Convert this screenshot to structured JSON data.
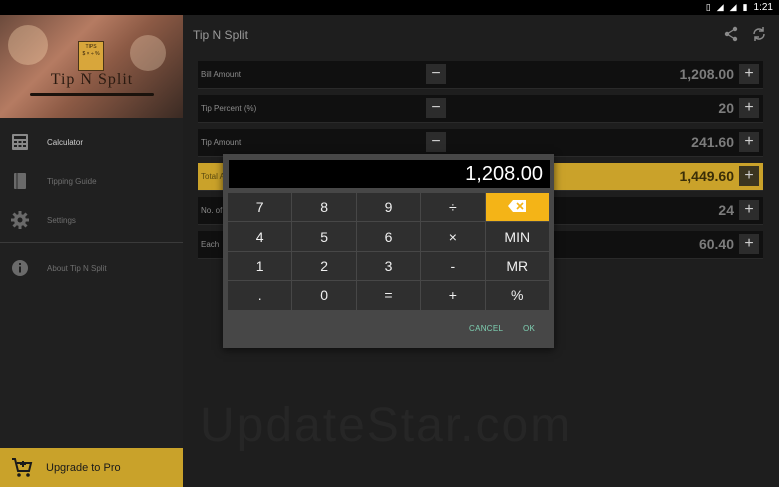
{
  "status_bar": {
    "time": "1:21",
    "icons": [
      "vibrate-icon",
      "wifi-icon",
      "signal-icon",
      "battery-icon"
    ]
  },
  "drawer": {
    "logo_badge": "TIPS",
    "logo_symbols": "$ × ÷ %",
    "logo_text": "Tip N Split",
    "items": [
      {
        "label": "Calculator",
        "icon": "calculator-icon",
        "active": true
      },
      {
        "label": "Tipping Guide",
        "icon": "book-icon",
        "active": false
      },
      {
        "label": "Settings",
        "icon": "gear-icon",
        "active": false
      },
      {
        "label": "About Tip N Split",
        "icon": "info-icon",
        "active": false
      }
    ],
    "upgrade_label": "Upgrade to Pro"
  },
  "appbar": {
    "title": "Tip N Split",
    "actions": [
      "share-icon",
      "refresh-icon"
    ]
  },
  "rows": [
    {
      "label": "Bill Amount",
      "value": "1,208.00",
      "has_minus": true
    },
    {
      "label": "Tip Percent (%)",
      "value": "20",
      "has_minus": true
    },
    {
      "label": "Tip Amount",
      "value": "241.60",
      "has_minus": true
    },
    {
      "label": "Total A",
      "value": "1,449.60",
      "has_minus": false,
      "highlight": true
    },
    {
      "label": "No. of",
      "value": "24",
      "has_minus": false
    },
    {
      "label": "Each",
      "value": "60.40",
      "has_minus": false
    }
  ],
  "watermark": "UpdateStar.com",
  "calculator": {
    "display": "1,208.00",
    "keys": [
      "7",
      "8",
      "9",
      "÷",
      "⌫",
      "4",
      "5",
      "6",
      "×",
      "MIN",
      "1",
      "2",
      "3",
      "-",
      "MR",
      ".",
      "0",
      "=",
      "+",
      "%"
    ],
    "cancel": "CANCEL",
    "ok": "OK"
  },
  "colors": {
    "accent": "#c9a22a",
    "backspace": "#f4b417",
    "dialog_button": "#7fd1b3"
  }
}
